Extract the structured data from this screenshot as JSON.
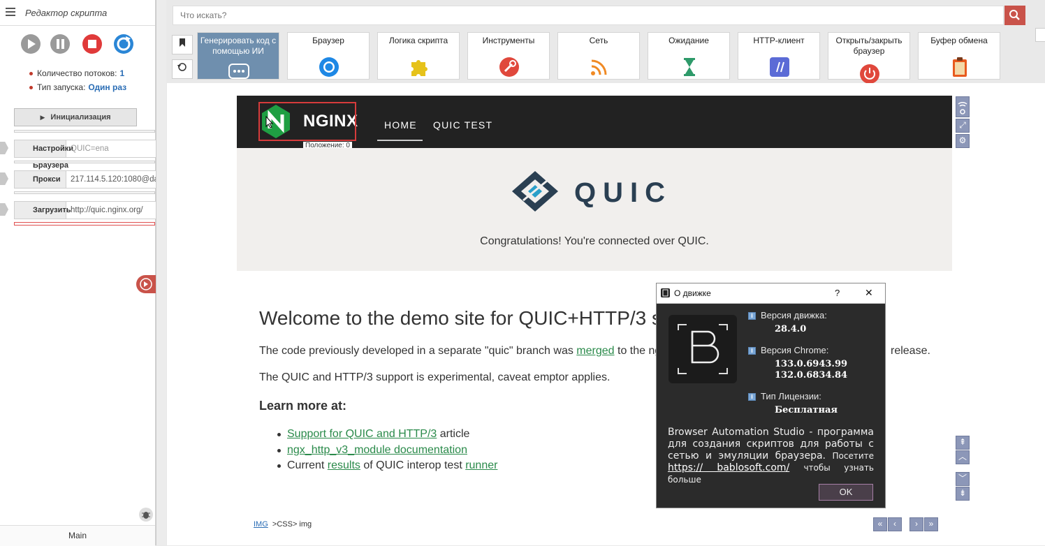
{
  "left_panel": {
    "title": "Редактор скрипта",
    "stats": [
      {
        "label": "Количество потоков:",
        "value": "1"
      },
      {
        "label": "Тип запуска:",
        "value": "Один раз"
      }
    ],
    "init_label": "Инициализация",
    "actions": [
      {
        "name": "Настройки Браузера",
        "value": "QUIC=ena"
      },
      {
        "name": "Прокси",
        "value": "217.114.5.120:1080@da"
      },
      {
        "name": "Загрузить",
        "value": "http://quic.nginx.org/"
      }
    ],
    "footer": "Main"
  },
  "toolbar": {
    "search_placeholder": "Что искать?",
    "categories": [
      {
        "label": "Генерировать код с помощью ИИ",
        "icon": "chat-icon"
      },
      {
        "label": "Браузер",
        "icon": "chrome-icon"
      },
      {
        "label": "Логика скрипта",
        "icon": "puzzle-icon"
      },
      {
        "label": "Инструменты",
        "icon": "wrench-icon"
      },
      {
        "label": "Сеть",
        "icon": "rss-icon"
      },
      {
        "label": "Ожидание",
        "icon": "hourglass-icon"
      },
      {
        "label": "HTTP-клиент",
        "icon": "http-icon"
      },
      {
        "label": "Открыть/закрыть браузер",
        "icon": "power-icon"
      },
      {
        "label": "Буфер обмена",
        "icon": "clipboard-icon"
      }
    ]
  },
  "site": {
    "brand": "NGINX",
    "position_label": "Положение: 0",
    "nav": [
      "HOME",
      "QUIC TEST"
    ],
    "quic_word": "QUIC",
    "congrats": "Congratulations! You're connected over QUIC.",
    "welcome": "Welcome to the demo site for QUIC+HTTP/3 su",
    "para1_a": "The code previously developed in a separate \"quic\" branch was ",
    "para1_link": "merged",
    "para1_b": " to the ngin",
    "para1_tail": "release.",
    "para2": "The QUIC and HTTP/3 support is experimental, caveat emptor applies.",
    "learn": "Learn more at:",
    "li1_link": "Support for QUIC and HTTP/3",
    "li1_text": " article",
    "li2_link": "ngx_http_v3_module documentation",
    "li3_a": "Current ",
    "li3_link1": "results",
    "li3_b": " of QUIC interop test ",
    "li3_link2": "runner"
  },
  "breadcrumb": {
    "link": "IMG",
    "rest": ">CSS> img"
  },
  "dialog": {
    "title": "О движке",
    "help": "?",
    "close": "✕",
    "engine_label": "Версия движка:",
    "engine_value": "28.4.0",
    "chrome_label": "Версия Chrome:",
    "chrome_values": [
      "133.0.6943.99",
      "132.0.6834.84"
    ],
    "license_label": "Тип Лицензии:",
    "license_value": "Бесплатная",
    "desc_main": "Browser Automation Studio - программа для создания скриптов для работы с сетью и эмуляции браузера.",
    "desc_visit": "Посетите",
    "desc_link": "https:// bablosoft.com/",
    "desc_tail": "чтобы узнать больше",
    "ok": "OK"
  },
  "colors": {
    "accent_red": "#c9534a",
    "nginx_green": "#1f9f43",
    "dialog_bg": "#2b2b2b",
    "ai_tile": "#6f8fae"
  }
}
